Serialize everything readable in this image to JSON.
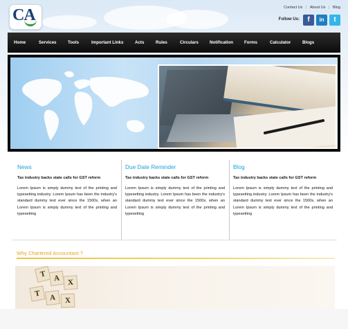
{
  "header": {
    "logo_text": "CA",
    "top_links": [
      "Contact Us",
      "About Us",
      "Blog"
    ],
    "follow_label": "Follow Us:",
    "social": [
      {
        "name": "facebook",
        "glyph": "f",
        "color": "#3b5998"
      },
      {
        "name": "linkedin",
        "glyph": "in",
        "color": "#1f7fbf"
      },
      {
        "name": "twitter",
        "glyph": "t",
        "color": "#33b6e8"
      }
    ]
  },
  "nav": {
    "items": [
      "Home",
      "Services",
      "Tools",
      "Important Links",
      "Acts",
      "Rules",
      "Circulars",
      "Notification",
      "Forms",
      "Calculator",
      "Blogs"
    ]
  },
  "columns": [
    {
      "title": "News",
      "subtitle": "Tax industry backs state calls for GST reform",
      "body": "Lorem Ipsum is simply dummy text of the printing and typesetting industry. Lorem Ipsum has been the industry's standard dummy text ever since the 1500s, when an Lorem Ipsum is simply dummy text of the printing and typesetting"
    },
    {
      "title": "Due Date Reminder",
      "subtitle": "Tax industry backs state calls for GST reform",
      "body": "Lorem Ipsum is simply dummy text of the printing and typesetting industry. Lorem Ipsum has been the industry's standard dummy text ever since the 1500s, when an Lorem Ipsum is simply dummy text of the printing and typesetting"
    },
    {
      "title": "Blog",
      "subtitle": "Tax industry backs state calls for GST reform",
      "body": "Lorem Ipsum is simply dummy text of the printing and typesetting industry. Lorem Ipsum has been the industry's standard dummy text ever since the 1500s, when an Lorem Ipsum is simply dummy text of the printing and typesetting"
    }
  ],
  "section": {
    "why_title": "Why Chartered Accountant ?",
    "dice_letters": [
      "T",
      "A",
      "X",
      "T",
      "A",
      "X"
    ]
  },
  "colors": {
    "accent_blue": "#19a3dc",
    "accent_gold": "#e8a31a",
    "nav_bg": "#111111"
  }
}
